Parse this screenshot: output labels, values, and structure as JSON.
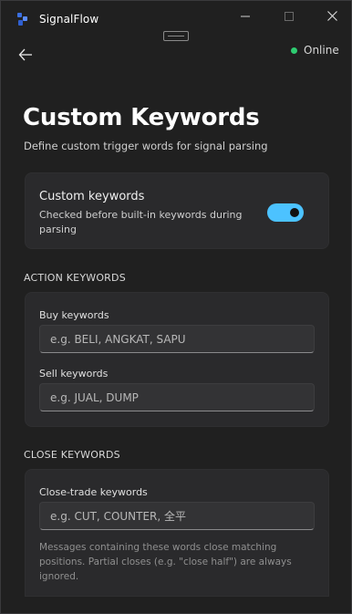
{
  "app": {
    "title": "SignalFlow",
    "status_label": "Online",
    "status_color": "#2ecc71",
    "accent_color": "#4cc2ff"
  },
  "window_controls": {
    "minimize_icon": "minimize-icon",
    "maximize_icon": "maximize-icon",
    "close_icon": "close-icon"
  },
  "page": {
    "title": "Custom Keywords",
    "subtitle": "Define custom trigger words for signal parsing"
  },
  "toggle_card": {
    "title": "Custom keywords",
    "description": "Checked before built-in keywords during parsing",
    "enabled": true
  },
  "action_section": {
    "header": "ACTION KEYWORDS",
    "buy_label": "Buy keywords",
    "buy_placeholder": "e.g. BELI, ANGKAT, SAPU",
    "buy_value": "",
    "sell_label": "Sell keywords",
    "sell_placeholder": "e.g. JUAL, DUMP",
    "sell_value": ""
  },
  "close_section": {
    "header": "CLOSE KEYWORDS",
    "close_label": "Close-trade keywords",
    "close_placeholder": "e.g. CUT, COUNTER, 全平",
    "close_value": "",
    "hint": "Messages containing these words close matching positions. Partial closes (e.g. \"close half\") are always ignored."
  }
}
